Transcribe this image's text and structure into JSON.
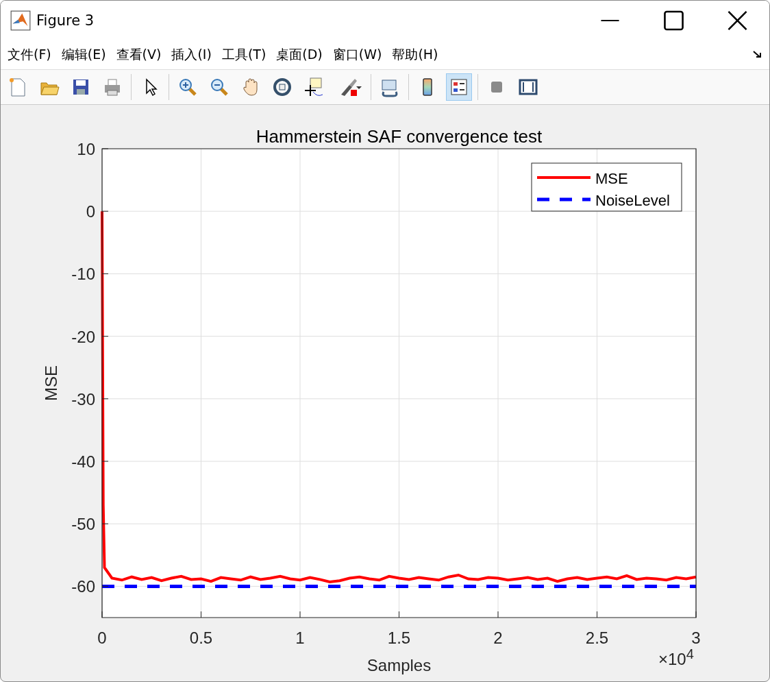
{
  "window": {
    "title": "Figure 3"
  },
  "menu": [
    {
      "label": "文件(F)"
    },
    {
      "label": "编辑(E)"
    },
    {
      "label": "查看(V)"
    },
    {
      "label": "插入(I)"
    },
    {
      "label": "工具(T)"
    },
    {
      "label": "桌面(D)"
    },
    {
      "label": "窗口(W)"
    },
    {
      "label": "帮助(H)"
    }
  ],
  "toolbar": [
    {
      "kind": "new",
      "selected": false
    },
    {
      "kind": "open",
      "selected": false
    },
    {
      "kind": "save",
      "selected": false
    },
    {
      "kind": "print",
      "selected": false
    },
    {
      "kind": "sep"
    },
    {
      "kind": "pointer",
      "selected": false
    },
    {
      "kind": "sep"
    },
    {
      "kind": "zoomin",
      "selected": false
    },
    {
      "kind": "zoomout",
      "selected": false
    },
    {
      "kind": "pan",
      "selected": false
    },
    {
      "kind": "rotate",
      "selected": false
    },
    {
      "kind": "cursor",
      "selected": false
    },
    {
      "kind": "brush",
      "selected": false
    },
    {
      "kind": "sep"
    },
    {
      "kind": "link",
      "selected": false
    },
    {
      "kind": "sep"
    },
    {
      "kind": "colorbar",
      "selected": false
    },
    {
      "kind": "legend",
      "selected": true
    },
    {
      "kind": "sep"
    },
    {
      "kind": "hide",
      "selected": false
    },
    {
      "kind": "show",
      "selected": false
    }
  ],
  "figure": {
    "chart_data": {
      "type": "line",
      "title": "Hammerstein SAF convergence test",
      "xlabel": "Samples",
      "ylabel": "MSE",
      "x": [
        0,
        0.006,
        0.012,
        0.05,
        0.1,
        0.15,
        0.2,
        0.25,
        0.3,
        0.35,
        0.4,
        0.45,
        0.5,
        0.55,
        0.6,
        0.65,
        0.7,
        0.75,
        0.8,
        0.85,
        0.9,
        0.95,
        1,
        1.05,
        1.1,
        1.15,
        1.2,
        1.25,
        1.3,
        1.35,
        1.4,
        1.45,
        1.5,
        1.55,
        1.6,
        1.65,
        1.7,
        1.75,
        1.8,
        1.85,
        1.9,
        1.95,
        2,
        2.05,
        2.1,
        2.15,
        2.2,
        2.25,
        2.3,
        2.35,
        2.4,
        2.45,
        2.5,
        2.55,
        2.6,
        2.65,
        2.7,
        2.75,
        2.8,
        2.85,
        2.9,
        2.95,
        3
      ],
      "series": [
        {
          "name": "MSE",
          "color": "#ff0000",
          "line_style": "solid",
          "values": [
            0,
            -47,
            -57,
            -58.7,
            -59.0,
            -58.5,
            -58.9,
            -58.6,
            -59.1,
            -58.7,
            -58.4,
            -58.9,
            -58.8,
            -59.2,
            -58.6,
            -58.8,
            -59.0,
            -58.5,
            -58.9,
            -58.7,
            -58.4,
            -58.8,
            -59.0,
            -58.6,
            -58.9,
            -59.3,
            -59.1,
            -58.7,
            -58.5,
            -58.8,
            -59.0,
            -58.4,
            -58.7,
            -58.9,
            -58.6,
            -58.8,
            -59.0,
            -58.5,
            -58.2,
            -58.8,
            -58.9,
            -58.6,
            -58.7,
            -59.0,
            -58.8,
            -58.6,
            -58.9,
            -58.7,
            -59.2,
            -58.8,
            -58.6,
            -58.9,
            -58.7,
            -58.5,
            -58.8,
            -58.3,
            -58.9,
            -58.7,
            -58.8,
            -59.0,
            -58.6,
            -58.8,
            -58.5
          ]
        },
        {
          "name": "NoiseLevel",
          "color": "#0000ff",
          "line_style": "dashed",
          "values": [
            -60,
            -60,
            -60,
            -60,
            -60,
            -60,
            -60,
            -60,
            -60,
            -60,
            -60,
            -60,
            -60,
            -60,
            -60,
            -60,
            -60,
            -60,
            -60,
            -60,
            -60,
            -60,
            -60,
            -60,
            -60,
            -60,
            -60,
            -60,
            -60,
            -60,
            -60,
            -60,
            -60,
            -60,
            -60,
            -60,
            -60,
            -60,
            -60,
            -60,
            -60,
            -60,
            -60,
            -60,
            -60,
            -60,
            -60,
            -60,
            -60,
            -60,
            -60,
            -60,
            -60,
            -60,
            -60,
            -60,
            -60,
            -60,
            -60,
            -60,
            -60,
            -60,
            -60
          ]
        }
      ],
      "xlim": [
        0,
        3
      ],
      "ylim": [
        -65,
        10
      ],
      "grid": true,
      "legend": "upper right",
      "xticks": [
        0,
        0.5,
        1,
        1.5,
        2,
        2.5,
        3
      ],
      "yticks": [
        10,
        0,
        -10,
        -20,
        -30,
        -40,
        -50,
        -60
      ],
      "annotations": [
        "×10$^{4}$"
      ]
    }
  }
}
